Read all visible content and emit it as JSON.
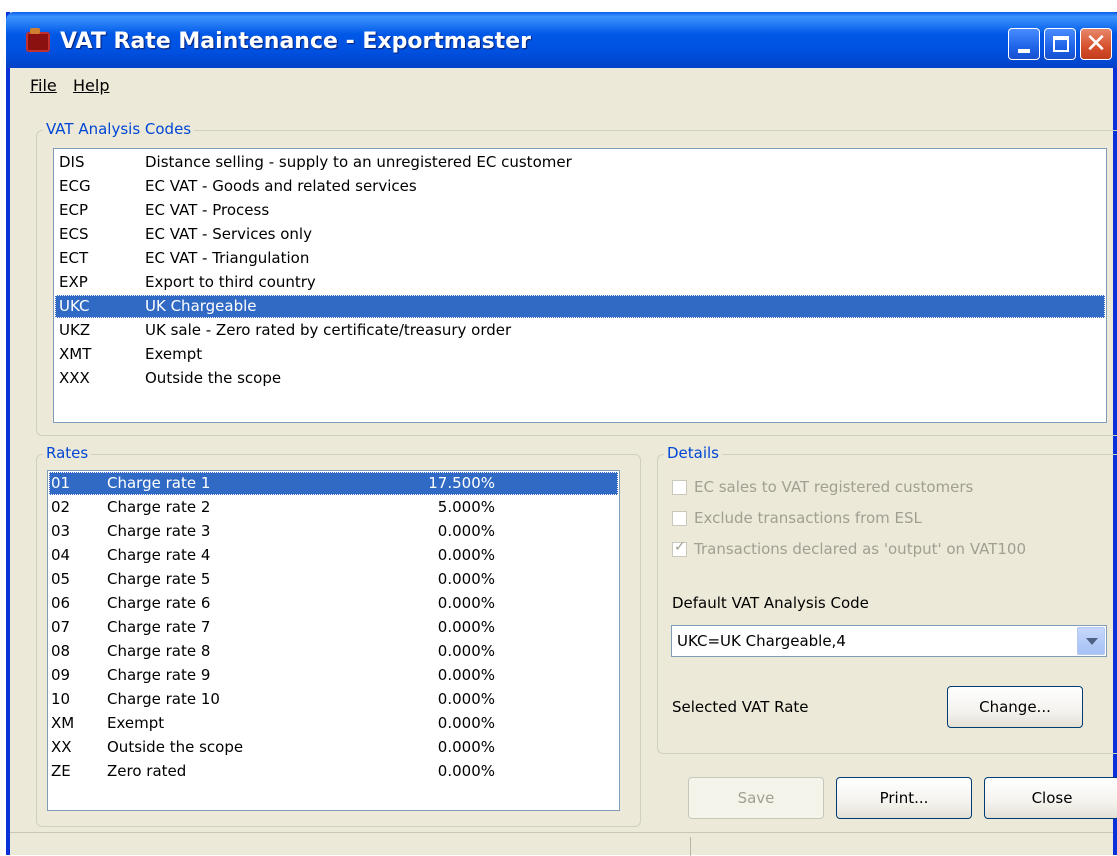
{
  "window": {
    "title": "VAT Rate Maintenance - Exportmaster"
  },
  "menu": {
    "file": "File",
    "help": "Help"
  },
  "codes_group": {
    "label": "VAT Analysis Codes",
    "items": [
      {
        "code": "DIS",
        "desc": "Distance selling - supply to an unregistered EC customer"
      },
      {
        "code": "ECG",
        "desc": "EC VAT - Goods and related services"
      },
      {
        "code": "ECP",
        "desc": "EC VAT - Process"
      },
      {
        "code": "ECS",
        "desc": "EC VAT - Services only"
      },
      {
        "code": "ECT",
        "desc": "EC VAT - Triangulation"
      },
      {
        "code": "EXP",
        "desc": "Export to third country"
      },
      {
        "code": "UKC",
        "desc": "UK Chargeable"
      },
      {
        "code": "UKZ",
        "desc": "UK sale - Zero rated by certificate/treasury order"
      },
      {
        "code": "XMT",
        "desc": "Exempt"
      },
      {
        "code": "XXX",
        "desc": "Outside the scope"
      }
    ]
  },
  "rates_group": {
    "label": "Rates",
    "items": [
      {
        "code": "01",
        "desc": "Charge rate 1",
        "rate": "17.500%"
      },
      {
        "code": "02",
        "desc": "Charge rate 2",
        "rate": "5.000%"
      },
      {
        "code": "03",
        "desc": "Charge rate 3",
        "rate": "0.000%"
      },
      {
        "code": "04",
        "desc": "Charge rate 4",
        "rate": "0.000%"
      },
      {
        "code": "05",
        "desc": "Charge rate 5",
        "rate": "0.000%"
      },
      {
        "code": "06",
        "desc": "Charge rate 6",
        "rate": "0.000%"
      },
      {
        "code": "07",
        "desc": "Charge rate 7",
        "rate": "0.000%"
      },
      {
        "code": "08",
        "desc": "Charge rate 8",
        "rate": "0.000%"
      },
      {
        "code": "09",
        "desc": "Charge rate 9",
        "rate": "0.000%"
      },
      {
        "code": "10",
        "desc": "Charge rate 10",
        "rate": "0.000%"
      },
      {
        "code": "XM",
        "desc": "Exempt",
        "rate": "0.000%"
      },
      {
        "code": "XX",
        "desc": "Outside the scope",
        "rate": "0.000%"
      },
      {
        "code": "ZE",
        "desc": "Zero rated",
        "rate": "0.000%"
      }
    ]
  },
  "details_group": {
    "label": "Details",
    "checkboxes": [
      {
        "label": "EC sales to VAT registered customers",
        "checked": false
      },
      {
        "label": "Exclude transactions from ESL",
        "checked": false
      },
      {
        "label": "Transactions declared as 'output' on VAT100",
        "checked": true
      }
    ],
    "default_code_label": "Default VAT Analysis Code",
    "default_code_value": "UKC=UK Chargeable,4",
    "selected_rate_label": "Selected VAT Rate",
    "change_button": "Change..."
  },
  "buttons": {
    "save": "Save",
    "print": "Print...",
    "close": "Close"
  },
  "colors": {
    "selection": "#316ac5",
    "group_label": "#0046d5",
    "dialog_bg": "#ece9d8"
  }
}
